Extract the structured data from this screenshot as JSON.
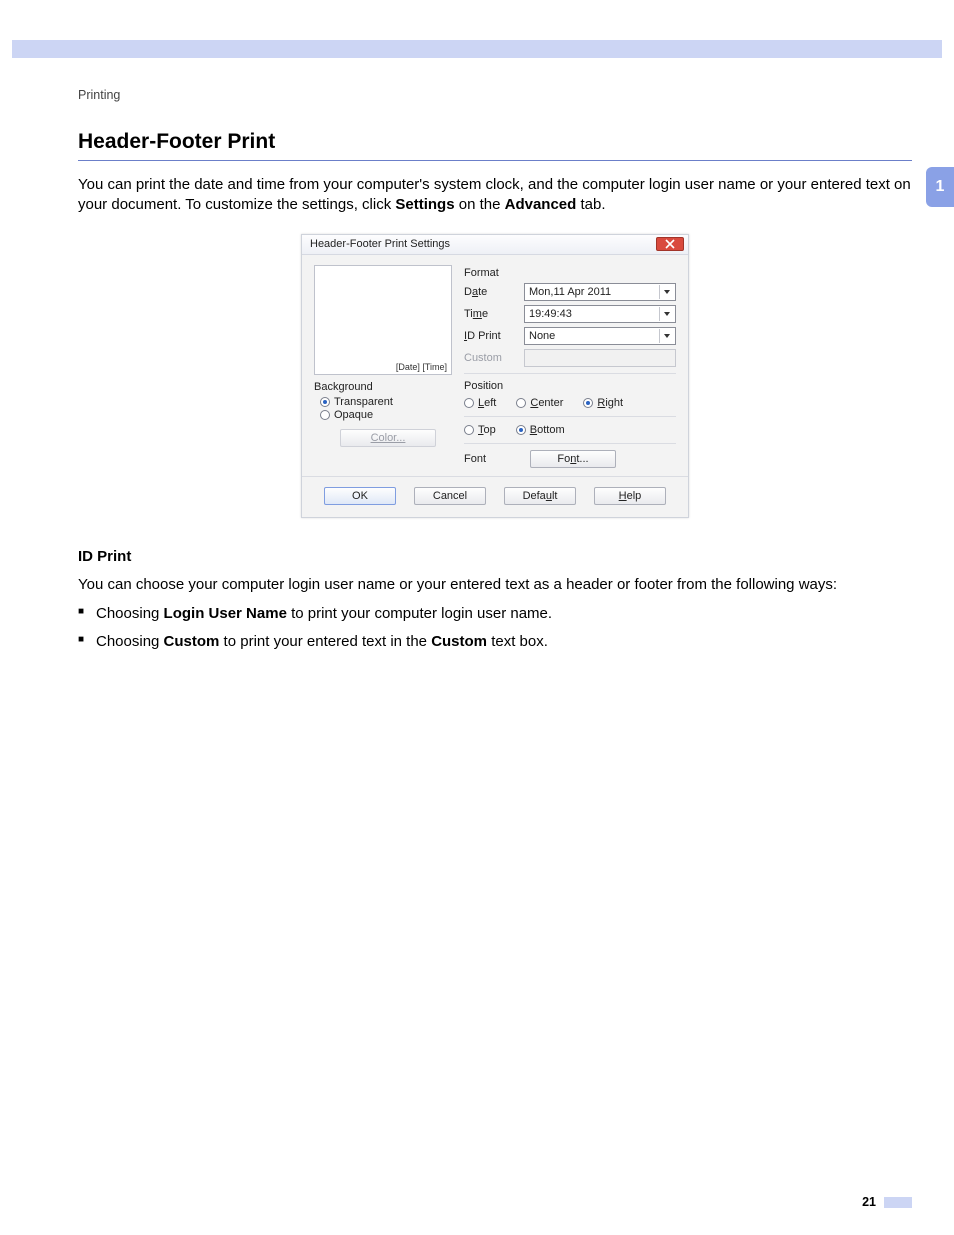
{
  "breadcrumb": "Printing",
  "side_tab": "1",
  "heading": "Header-Footer Print",
  "intro_pre": "You can print the date and time from your computer's system clock, and the computer login user name or your entered text on your document. To customize the settings, click ",
  "intro_b1": "Settings",
  "intro_mid": " on the ",
  "intro_b2": "Advanced",
  "intro_post": " tab.",
  "dialog": {
    "title": "Header-Footer Print Settings",
    "preview_text": "[Date] [Time]",
    "background": {
      "heading": "Background",
      "transparent": "Transparent",
      "opaque": "Opaque",
      "color_btn": "Color..."
    },
    "format": {
      "heading": "Format",
      "date_label": "Date",
      "date_value": "Mon,11 Apr 2011",
      "time_label": "Time",
      "time_value": "19:49:43",
      "id_label": "ID Print",
      "id_value": "None",
      "custom_label": "Custom"
    },
    "position": {
      "heading": "Position",
      "left": "Left",
      "center": "Center",
      "right": "Right",
      "top": "Top",
      "bottom": "Bottom"
    },
    "font": {
      "label": "Font",
      "button": "Font..."
    },
    "buttons": {
      "ok": "OK",
      "cancel": "Cancel",
      "default": "Default",
      "help": "Help"
    }
  },
  "id_heading": "ID Print",
  "id_para": "You can choose your computer login user name or your entered text  as a header or footer from the following ways:",
  "bullets": {
    "b1_pre": "Choosing ",
    "b1_bold": "Login User Name",
    "b1_post": " to print your computer login user name.",
    "b2_pre": "Choosing ",
    "b2_bold1": "Custom",
    "b2_mid": " to print your entered text in the ",
    "b2_bold2": "Custom",
    "b2_post": " text box."
  },
  "page_number": "21"
}
